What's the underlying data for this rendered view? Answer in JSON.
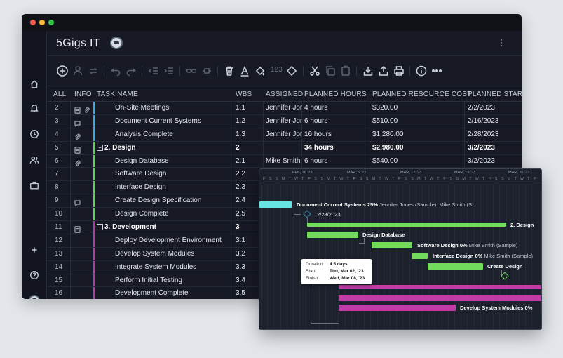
{
  "project": {
    "title": "5Gigs IT"
  },
  "toolbar": {
    "count_label": "123"
  },
  "grid": {
    "columns": [
      "ALL",
      "INFO",
      "TASK NAME",
      "WBS",
      "ASSIGNED",
      "PLANNED HOURS",
      "PLANNED RESOURCE COST",
      "PLANNED START"
    ],
    "rows": [
      {
        "num": "2",
        "name": "On-Site Meetings",
        "wbs": "1.1",
        "assigned": "Jennifer Jon",
        "hours": "4 hours",
        "cost": "$320.00",
        "start": "2/2/2023",
        "info": [
          "doc",
          "clip"
        ],
        "bar": "#3aa9d9",
        "summary": false
      },
      {
        "num": "3",
        "name": "Document Current Systems",
        "wbs": "1.2",
        "assigned": "Jennifer Jon",
        "hours": "6 hours",
        "cost": "$510.00",
        "start": "2/16/2023",
        "info": [
          "chat"
        ],
        "bar": "#3aa9d9",
        "summary": false
      },
      {
        "num": "4",
        "name": "Analysis Complete",
        "wbs": "1.3",
        "assigned": "Jennifer Jon",
        "hours": "16 hours",
        "cost": "$1,280.00",
        "start": "2/28/2023",
        "info": [
          "clip"
        ],
        "bar": "#3aa9d9",
        "summary": false
      },
      {
        "num": "5",
        "name": "2. Design",
        "wbs": "2",
        "assigned": "",
        "hours": "34 hours",
        "cost": "$2,980.00",
        "start": "3/2/2023",
        "info": [
          "doc"
        ],
        "bar": "#5fd34f",
        "summary": true
      },
      {
        "num": "6",
        "name": "Design Database",
        "wbs": "2.1",
        "assigned": "Mike Smith",
        "hours": "6 hours",
        "cost": "$540.00",
        "start": "3/2/2023",
        "info": [
          "clip"
        ],
        "bar": "#5fd34f",
        "summary": false
      },
      {
        "num": "7",
        "name": "Software Design",
        "wbs": "2.2",
        "assigned": "",
        "hours": "",
        "cost": "",
        "start": "",
        "info": [],
        "bar": "#5fd34f",
        "summary": false
      },
      {
        "num": "8",
        "name": "Interface Design",
        "wbs": "2.3",
        "assigned": "",
        "hours": "",
        "cost": "",
        "start": "",
        "info": [],
        "bar": "#5fd34f",
        "summary": false
      },
      {
        "num": "9",
        "name": "Create Design Specification",
        "wbs": "2.4",
        "assigned": "",
        "hours": "",
        "cost": "",
        "start": "",
        "info": [
          "chat"
        ],
        "bar": "#5fd34f",
        "summary": false
      },
      {
        "num": "10",
        "name": "Design Complete",
        "wbs": "2.5",
        "assigned": "",
        "hours": "",
        "cost": "",
        "start": "",
        "info": [],
        "bar": "#5fd34f",
        "summary": false
      },
      {
        "num": "11",
        "name": "3. Development",
        "wbs": "3",
        "assigned": "",
        "hours": "",
        "cost": "",
        "start": "",
        "info": [
          "doc"
        ],
        "bar": "#b43aa6",
        "summary": true
      },
      {
        "num": "12",
        "name": "Deploy Development Environment",
        "wbs": "3.1",
        "assigned": "",
        "hours": "",
        "cost": "",
        "start": "",
        "info": [],
        "bar": "#b43aa6",
        "summary": false
      },
      {
        "num": "13",
        "name": "Develop System Modules",
        "wbs": "3.2",
        "assigned": "",
        "hours": "",
        "cost": "",
        "start": "",
        "info": [],
        "bar": "#b43aa6",
        "summary": false
      },
      {
        "num": "14",
        "name": "Integrate System Modules",
        "wbs": "3.3",
        "assigned": "",
        "hours": "",
        "cost": "",
        "start": "",
        "info": [],
        "bar": "#b43aa6",
        "summary": false
      },
      {
        "num": "15",
        "name": "Perform Initial Testing",
        "wbs": "3.4",
        "assigned": "",
        "hours": "",
        "cost": "",
        "start": "",
        "info": [],
        "bar": "#b43aa6",
        "summary": false
      },
      {
        "num": "16",
        "name": "Development Complete",
        "wbs": "3.5",
        "assigned": "",
        "hours": "",
        "cost": "",
        "start": "",
        "info": [],
        "bar": "#b43aa6",
        "summary": false
      }
    ]
  },
  "gantt": {
    "weeks": [
      "FEB, 26 '23",
      "MAR, 5 '23",
      "MAR, 12 '23",
      "MAR, 19 '23",
      "MAR, 26 '23"
    ],
    "day_letters": [
      "F",
      "S",
      "S",
      "M",
      "T",
      "W",
      "T",
      "F",
      "S",
      "S",
      "M",
      "T",
      "W",
      "T",
      "F",
      "S",
      "S",
      "M",
      "T",
      "W",
      "T",
      "F",
      "S",
      "S",
      "M",
      "T",
      "W",
      "T",
      "F",
      "S",
      "S",
      "M",
      "T",
      "W",
      "T",
      "F",
      "S",
      "S",
      "M",
      "T",
      "W",
      "T",
      "F"
    ],
    "labels": {
      "doc_current": "Document Current Systems",
      "doc_current_pct": "25%",
      "doc_current_res": "Jennifer Jones (Sample), Mike Smith (S...",
      "milestone_date": "2/28/2023",
      "design": "2. Design",
      "design_db": "Design Database",
      "software": "Software Design",
      "software_pct": "0%",
      "software_res": "Mike Smith (Sample)",
      "interface": "Interface Design",
      "interface_pct": "0%",
      "interface_res": "Mike Smith (Sample)",
      "create_spec": "Create Design",
      "dev_modules": "Develop System Modules",
      "dev_modules_pct": "0%"
    },
    "tooltip": {
      "duration_label": "Duration",
      "duration_value": "4.5 days",
      "start_label": "Start",
      "start_value": "Thu, Mar 02, '23",
      "finish_label": "Finish",
      "finish_value": "Wed, Mar 08, '23"
    },
    "colors": {
      "cyan": "#66e3e3",
      "green": "#73db5c",
      "magenta": "#c23aa5"
    }
  }
}
